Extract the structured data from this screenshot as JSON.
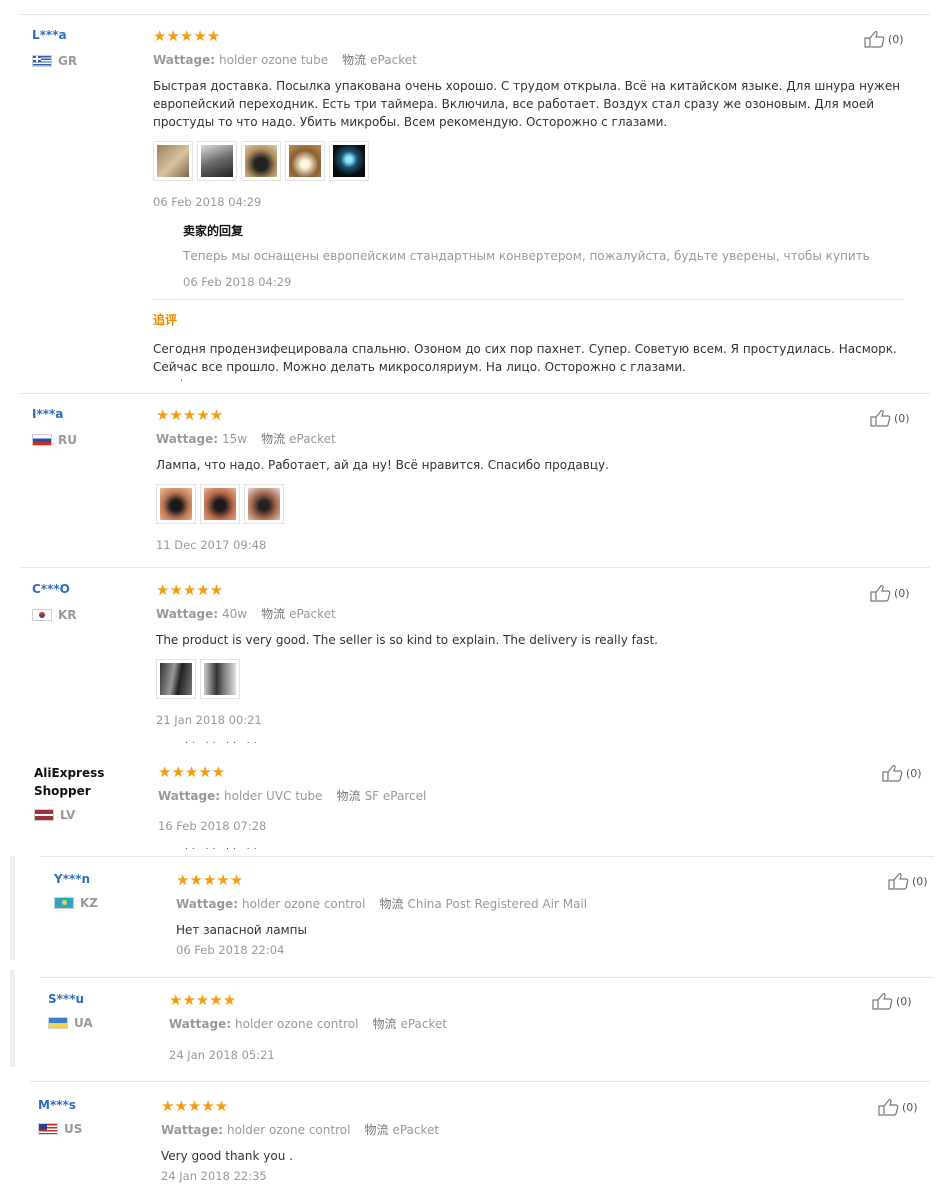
{
  "labels": {
    "wattage": "Wattage:",
    "shipping": "物流",
    "seller_reply_title": "卖家的回复",
    "additional_review_title": "追评"
  },
  "colors": {
    "stars": "#f39c12",
    "username": "#2b6ec2",
    "additional": "#e88a00"
  },
  "reviews": [
    {
      "user": "L***a",
      "country": "GR",
      "stars": "★★★★★",
      "wattage": "holder ozone tube",
      "shipping": "ePacket",
      "text": "Быстрая доставка. Посылка упакована очень хорошо. С трудом открыла. Всё на китайском языке. Для шнура нужен европейский переходник. Есть три таймера. Включила, все работает. Воздух стал сразу же озоновым. Для моей простуды то что надо. Убить микробы. Всем рекомендую. Осторожно с глазами.",
      "date": "06 Feb 2018 04:29",
      "helpful": "(0)",
      "reply_text": "Теперь мы оснащены европейским стандартным конвертером, пожалуйста, будьте уверены, чтобы купить",
      "reply_date": "06 Feb 2018 04:29",
      "additional_text": "Сегодня продензифецировала спальню. Озоном до сих пор пахнет. Супер. Советую всем. Я простудилась. Насморк. Сейчас все прошло. Можно делать микросоляриум. На лицо. Осторожно с глазами."
    },
    {
      "user": "I***a",
      "country": "RU",
      "stars": "★★★★★",
      "wattage": "15w",
      "shipping": "ePacket",
      "text": "Лампа, что надо. Работает, ай да ну! Всё нравится. Спасибо продавцу.",
      "date": "11 Dec 2017 09:48",
      "helpful": "(0)"
    },
    {
      "user": "C***O",
      "country": "KR",
      "stars": "★★★★★",
      "wattage": "40w",
      "shipping": "ePacket",
      "text": "The product is very good. The seller is so kind to explain. The delivery is really fast.",
      "date": "21 Jan 2018 00:21",
      "helpful": "(0)"
    },
    {
      "user": "AliExpress Shopper",
      "country": "LV",
      "stars": "★★★★★",
      "wattage": "holder UVC tube",
      "shipping": "SF eParcel",
      "date": "16 Feb 2018 07:28",
      "helpful": "(0)"
    },
    {
      "user": "Y***n",
      "country": "KZ",
      "stars": "★★★★★",
      "wattage": "holder ozone control",
      "shipping": "China Post Registered Air Mail",
      "text": "Нет запасной лампы",
      "date": "06 Feb 2018 22:04",
      "helpful": "(0)"
    },
    {
      "user": "S***u",
      "country": "UA",
      "stars": "★★★★★",
      "wattage": "holder ozone control",
      "shipping": "ePacket",
      "date": "24 Jan 2018 05:21",
      "helpful": "(0)"
    },
    {
      "user": "M***s",
      "country": "US",
      "stars": "★★★★★",
      "wattage": "holder ozone control",
      "shipping": "ePacket",
      "text": "Very good thank you .",
      "date": "24 Jan 2018 22:35",
      "helpful": "(0)"
    }
  ]
}
